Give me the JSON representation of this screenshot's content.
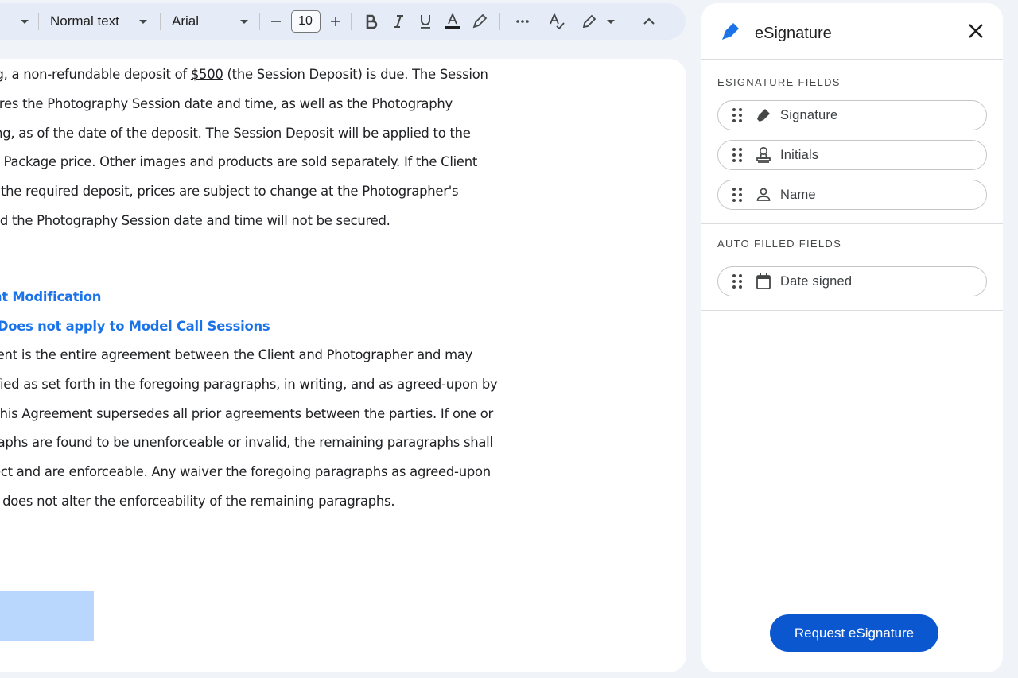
{
  "toolbar": {
    "style_value": "Normal text",
    "font_value": "Arial",
    "font_size": "10"
  },
  "document": {
    "lines": [
      {
        "pre": "ing, a non-refundable deposit of ",
        "amount": "$500",
        "post": " (the Session Deposit) is due. The Session"
      },
      "cures the Photography Session date and time, as well as the Photography",
      "cing, as of the date of the deposit. The Session Deposit will be applied to the",
      "hy Package price. Other images and products are sold separately. If the Client",
      "te the required deposit, prices are subject to change at the Photographer's",
      "and the Photography Session date and time will not be secured."
    ],
    "heading_1": "ent Modification",
    "heading_2_prefix": ".",
    "heading_2": "Does not apply to Model Call Sessions",
    "lines2": [
      "ment is the entire agreement between the Client and Photographer and may",
      "dified as set forth in the foregoing paragraphs, in writing, and as agreed-upon by",
      ". This Agreement supersedes all prior agreements between the parties. If one or",
      "graphs are found to be unenforceable or invalid, the remaining paragraphs shall",
      "ffect and are enforceable. Any waiver the foregoing paragraphs as agreed-upon",
      "es does not alter the enforceability of the remaining paragraphs."
    ]
  },
  "panel": {
    "title": "eSignature",
    "esignature_section": "ESIGNATURE FIELDS",
    "esignature_fields": [
      {
        "label": "Signature",
        "icon": "pen-icon"
      },
      {
        "label": "Initials",
        "icon": "stamp-icon"
      },
      {
        "label": "Name",
        "icon": "person-icon"
      }
    ],
    "auto_section": "AUTO FILLED FIELDS",
    "auto_fields": [
      {
        "label": "Date signed",
        "icon": "calendar-icon"
      }
    ],
    "request_button": "Request eSignature"
  },
  "colors": {
    "accent": "#0b57d0",
    "heading": "#1a73e8",
    "highlight": "#b9d6fc"
  }
}
